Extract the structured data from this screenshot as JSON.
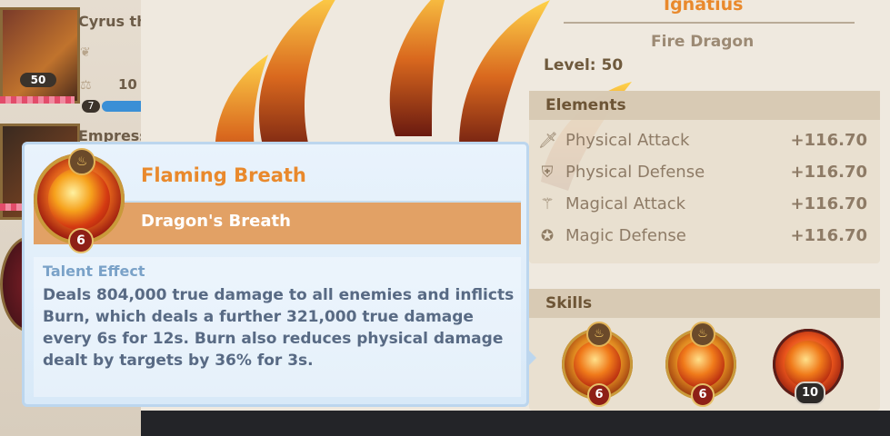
{
  "hero_list": [
    {
      "name": "Cyrus th",
      "level": "50",
      "stat_value": "10",
      "badge": "7"
    },
    {
      "name": "Empress"
    }
  ],
  "hero_detail": {
    "name": "Ignatius",
    "subtitle": "Fire Dragon",
    "level_label": "Level: 50"
  },
  "elements": {
    "header": "Elements",
    "stats": [
      {
        "name": "Physical Attack",
        "value": "+116.70",
        "icon": "sword-icon"
      },
      {
        "name": "Physical Defense",
        "value": "+116.70",
        "icon": "shield-icon"
      },
      {
        "name": "Magical Attack",
        "value": "+116.70",
        "icon": "staff-icon"
      },
      {
        "name": "Magic Defense",
        "value": "+116.70",
        "icon": "magic-shield-icon"
      }
    ]
  },
  "skills": {
    "header": "Skills",
    "items": [
      {
        "level": "6",
        "icon": "dragon-breath-icon"
      },
      {
        "level": "6",
        "icon": "dragon-roar-icon"
      },
      {
        "level": "10",
        "icon": "flame-burst-icon"
      }
    ]
  },
  "tooltip": {
    "skill_name": "Flaming Breath",
    "skill_type": "Dragon's Breath",
    "skill_level": "6",
    "effect_label": "Talent Effect",
    "description": "Deals 804,000 true damage to all enemies and inflicts Burn, which deals a further 321,000 true damage every 6s for 12s. Burn also reduces physical damage dealt by targets by 36% for 3s."
  },
  "colors": {
    "accent_orange": "#e9892c",
    "tooltip_bg": "#e3effa",
    "banner": "#e2a165",
    "description_text": "#586a84"
  }
}
